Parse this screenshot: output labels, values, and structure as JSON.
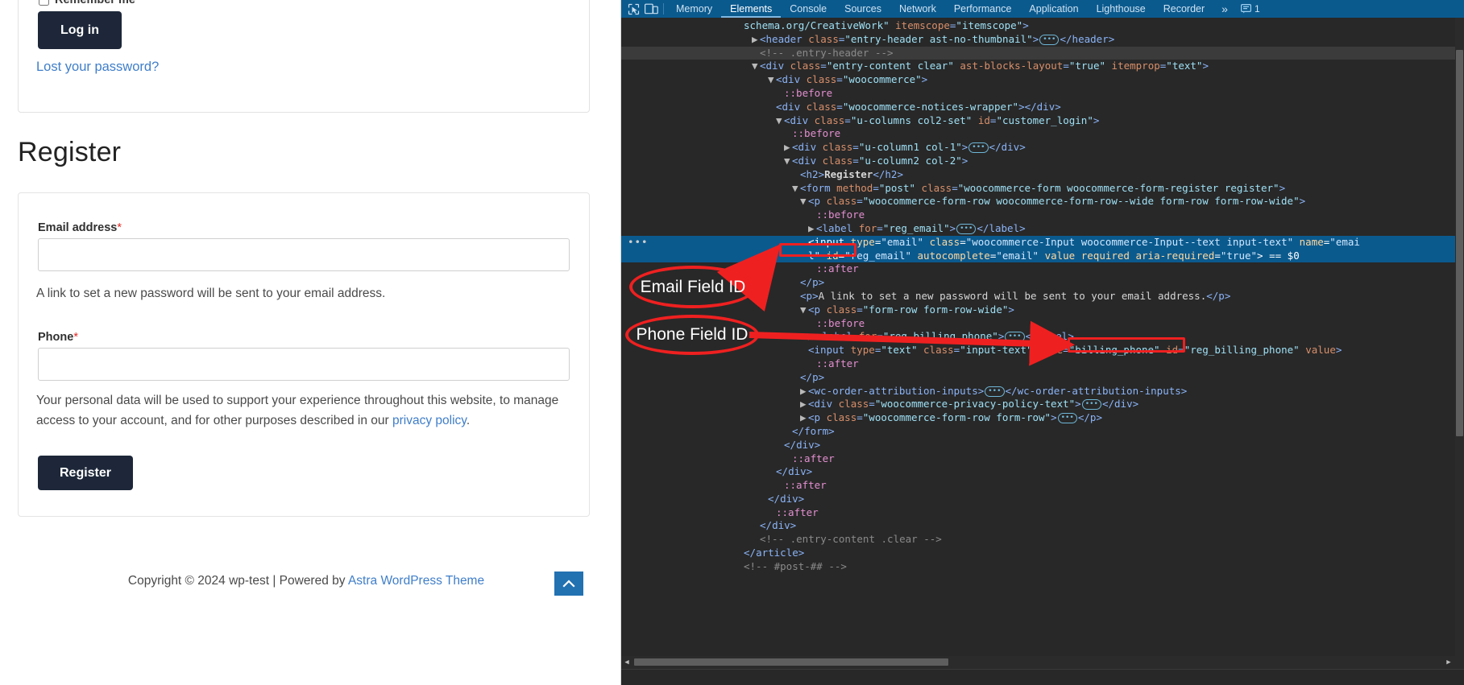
{
  "page": {
    "remember_me_label": "Remember me",
    "login_button": "Log in",
    "lost_password_link": "Lost your password?",
    "register_heading": "Register",
    "email_label": "Email address",
    "email_value": "",
    "email_placeholder": "",
    "email_helper": "A link to set a new password will be sent to your email address.",
    "phone_label": "Phone",
    "phone_value": "",
    "phone_placeholder": "",
    "required_marker": "*",
    "privacy_prefix": "Your personal data will be used to support your experience throughout this website, to manage access to your account, and for other purposes described in our ",
    "privacy_link": "privacy policy",
    "privacy_suffix": ".",
    "register_button": "Register",
    "copyright_prefix": "Copyright © 2024 wp-test | Powered by ",
    "copyright_link": "Astra WordPress Theme",
    "scroll_top_icon": "chevron-up-icon",
    "link_color": "#3f7ec9",
    "button_color": "#1d2739",
    "required_color": "#e02b27"
  },
  "devtools": {
    "accent_color": "#0b5a8e",
    "inspect_icon": "inspect-element-icon",
    "device_icon": "device-toolbar-icon",
    "tabs": [
      {
        "label": "Memory",
        "active": false
      },
      {
        "label": "Elements",
        "active": true
      },
      {
        "label": "Console",
        "active": false
      },
      {
        "label": "Sources",
        "active": false
      },
      {
        "label": "Network",
        "active": false
      },
      {
        "label": "Performance",
        "active": false
      },
      {
        "label": "Application",
        "active": false
      },
      {
        "label": "Lighthouse",
        "active": false
      },
      {
        "label": "Recorder",
        "active": false
      }
    ],
    "more_tabs_label": "»",
    "issues_icon": "issues-icon",
    "issues_count": "1",
    "dom_lines": [
      {
        "indent": 6,
        "state": "none",
        "html": "<span class=\"val\">schema.org/CreativeWork\"</span> <span class=\"attr\">itemscope</span><span class=\"punc\">=</span><span class=\"val\">\"itemscope\"</span><span class=\"punc\">&gt;</span>"
      },
      {
        "indent": 7,
        "state": "none",
        "html": "<span class=\"tri\">▶</span><span class=\"punc\">&lt;</span><span class=\"tag\">header</span> <span class=\"attr\">class</span><span class=\"punc\">=</span><span class=\"val\">\"entry-header ast-no-thumbnail\"</span><span class=\"punc\">&gt;</span><span class=\"ell\">•••</span><span class=\"punc\">&lt;/</span><span class=\"tag\">header</span><span class=\"punc\">&gt;</span>"
      },
      {
        "indent": 8,
        "state": "grey",
        "html": "<span class=\"comment\">&lt;!-- .entry-header --&gt;</span>"
      },
      {
        "indent": 7,
        "state": "none",
        "html": "<span class=\"tri\">▼</span><span class=\"punc\">&lt;</span><span class=\"tag\">div</span> <span class=\"attr\">class</span><span class=\"punc\">=</span><span class=\"val\">\"entry-content clear\"</span> <span class=\"attr\">ast-blocks-layout</span><span class=\"punc\">=</span><span class=\"val\">\"true\"</span> <span class=\"attr\">itemprop</span><span class=\"punc\">=</span><span class=\"val\">\"text\"</span><span class=\"punc\">&gt;</span>"
      },
      {
        "indent": 9,
        "state": "none",
        "html": "<span class=\"tri\">▼</span><span class=\"punc\">&lt;</span><span class=\"tag\">div</span> <span class=\"attr\">class</span><span class=\"punc\">=</span><span class=\"val\">\"woocommerce\"</span><span class=\"punc\">&gt;</span>"
      },
      {
        "indent": 11,
        "state": "none",
        "html": "<span class=\"pseudo\">::before</span>"
      },
      {
        "indent": 10,
        "state": "none",
        "html": "<span class=\"punc\">&lt;</span><span class=\"tag\">div</span> <span class=\"attr\">class</span><span class=\"punc\">=</span><span class=\"val\">\"woocommerce-notices-wrapper\"</span><span class=\"punc\">&gt;&lt;/</span><span class=\"tag\">div</span><span class=\"punc\">&gt;</span>"
      },
      {
        "indent": 10,
        "state": "none",
        "html": "<span class=\"tri\">▼</span><span class=\"punc\">&lt;</span><span class=\"tag\">div</span> <span class=\"attr\">class</span><span class=\"punc\">=</span><span class=\"val\">\"u-columns col2-set\"</span> <span class=\"attr\">id</span><span class=\"punc\">=</span><span class=\"val\">\"customer_login\"</span><span class=\"punc\">&gt;</span>"
      },
      {
        "indent": 12,
        "state": "none",
        "html": "<span class=\"pseudo\">::before</span>"
      },
      {
        "indent": 11,
        "state": "none",
        "html": "<span class=\"tri\">▶</span><span class=\"punc\">&lt;</span><span class=\"tag\">div</span> <span class=\"attr\">class</span><span class=\"punc\">=</span><span class=\"val\">\"u-column1 col-1\"</span><span class=\"punc\">&gt;</span><span class=\"ell\">•••</span><span class=\"punc\">&lt;/</span><span class=\"tag\">div</span><span class=\"punc\">&gt;</span>"
      },
      {
        "indent": 11,
        "state": "none",
        "html": "<span class=\"tri\">▼</span><span class=\"punc\">&lt;</span><span class=\"tag\">div</span> <span class=\"attr\">class</span><span class=\"punc\">=</span><span class=\"val\">\"u-column2 col-2\"</span><span class=\"punc\">&gt;</span>"
      },
      {
        "indent": 13,
        "state": "none",
        "html": "<span class=\"punc\">&lt;</span><span class=\"tag\">h2</span><span class=\"punc\">&gt;</span><span class=\"txt\" style=\"font-weight:bold\">Register</span><span class=\"punc\">&lt;/</span><span class=\"tag\">h2</span><span class=\"punc\">&gt;</span>"
      },
      {
        "indent": 12,
        "state": "none",
        "html": "<span class=\"tri\">▼</span><span class=\"punc\">&lt;</span><span class=\"tag\">form</span> <span class=\"attr\">method</span><span class=\"punc\">=</span><span class=\"val\">\"post\"</span> <span class=\"attr\">class</span><span class=\"punc\">=</span><span class=\"val\">\"woocommerce-form woocommerce-form-register register\"</span><span class=\"punc\">&gt;</span>"
      },
      {
        "indent": 13,
        "state": "none",
        "html": "<span class=\"tri\">▼</span><span class=\"punc\">&lt;</span><span class=\"tag\">p</span> <span class=\"attr\">class</span><span class=\"punc\">=</span><span class=\"val\">\"woocommerce-form-row woocommerce-form-row--wide form-row form-row-wide\"</span><span class=\"punc\">&gt;</span>"
      },
      {
        "indent": 15,
        "state": "none",
        "html": "<span class=\"pseudo\">::before</span>"
      },
      {
        "indent": 14,
        "state": "none",
        "html": "<span class=\"tri\">▶</span><span class=\"punc\">&lt;</span><span class=\"tag\">label</span> <span class=\"attr\">for</span><span class=\"punc\">=</span><span class=\"val\">\"reg_email\"</span><span class=\"punc\">&gt;</span><span class=\"ell\">•••</span><span class=\"punc\">&lt;/</span><span class=\"tag\">label</span><span class=\"punc\">&gt;</span>"
      },
      {
        "indent": 14,
        "state": "sel",
        "html": "<span class=\"punc\">&lt;</span><span class=\"tag\">input</span> <span class=\"attr\">type</span><span class=\"punc\">=</span><span class=\"val\">\"email\"</span> <span class=\"attr\">class</span><span class=\"punc\">=</span><span class=\"val\">\"woocommerce-Input woocommerce-Input--text input-text\"</span> <span class=\"attr\">name</span><span class=\"punc\">=</span><span class=\"val\">\"emai</span>"
      },
      {
        "indent": 14,
        "state": "sel2",
        "html": "<span class=\"val\">l\"</span> <span class=\"attr\">id</span><span class=\"punc\">=</span><span class=\"val\">\"reg_email\"</span> <span class=\"attr\">autocomplete</span><span class=\"punc\">=</span><span class=\"val\">\"email\"</span> <span class=\"attr\">value</span> <span class=\"attr\">required</span> <span class=\"attr\">aria-required</span><span class=\"punc\">=</span><span class=\"val\">\"true\"</span><span class=\"punc\">&gt;</span> <span class=\"txt\">== $0</span>"
      },
      {
        "indent": 15,
        "state": "none",
        "html": "<span class=\"pseudo\">::after</span>"
      },
      {
        "indent": 13,
        "state": "none",
        "html": "<span class=\"punc\">&lt;/</span><span class=\"tag\">p</span><span class=\"punc\">&gt;</span>"
      },
      {
        "indent": 13,
        "state": "none",
        "html": "<span class=\"punc\">&lt;</span><span class=\"tag\">p</span><span class=\"punc\">&gt;</span><span class=\"txt\">A link to set a new password will be sent to your email address.</span><span class=\"punc\">&lt;/</span><span class=\"tag\">p</span><span class=\"punc\">&gt;</span>"
      },
      {
        "indent": 13,
        "state": "none",
        "html": "<span class=\"tri\">▼</span><span class=\"punc\">&lt;</span><span class=\"tag\">p</span> <span class=\"attr\">class</span><span class=\"punc\">=</span><span class=\"val\">\"form-row form-row-wide\"</span><span class=\"punc\">&gt;</span>"
      },
      {
        "indent": 15,
        "state": "none",
        "html": "<span class=\"pseudo\">::before</span>"
      },
      {
        "indent": 14,
        "state": "none",
        "html": "<span class=\"tri\">▶</span><span class=\"punc\">&lt;</span><span class=\"tag\">label</span> <span class=\"attr\">for</span><span class=\"punc\">=</span><span class=\"val\">\"reg_billing_phone\"</span><span class=\"punc\">&gt;</span><span class=\"ell\">•••</span><span class=\"punc\">&lt;/</span><span class=\"tag\">label</span><span class=\"punc\">&gt;</span>"
      },
      {
        "indent": 14,
        "state": "none",
        "html": "<span class=\"punc\">&lt;</span><span class=\"tag\">input</span> <span class=\"attr\">type</span><span class=\"punc\">=</span><span class=\"val\">\"text\"</span> <span class=\"attr\">class</span><span class=\"punc\">=</span><span class=\"val\">\"input-text\"</span> <span class=\"attr\">name</span><span class=\"punc\">=</span><span class=\"val\">\"billing_phone\"</span> <span class=\"attr\">id</span><span class=\"punc\">=</span><span class=\"val\">\"reg_billing_phone\"</span> <span class=\"attr\">value</span><span class=\"punc\">&gt;</span>"
      },
      {
        "indent": 15,
        "state": "none",
        "html": "<span class=\"pseudo\">::after</span>"
      },
      {
        "indent": 13,
        "state": "none",
        "html": "<span class=\"punc\">&lt;/</span><span class=\"tag\">p</span><span class=\"punc\">&gt;</span>"
      },
      {
        "indent": 13,
        "state": "none",
        "html": "<span class=\"tri\">▶</span><span class=\"punc\">&lt;</span><span class=\"tag\">wc-order-attribution-inputs</span><span class=\"punc\">&gt;</span><span class=\"ell\">•••</span><span class=\"punc\">&lt;/</span><span class=\"tag\">wc-order-attribution-inputs</span><span class=\"punc\">&gt;</span>"
      },
      {
        "indent": 13,
        "state": "none",
        "html": "<span class=\"tri\">▶</span><span class=\"punc\">&lt;</span><span class=\"tag\">div</span> <span class=\"attr\">class</span><span class=\"punc\">=</span><span class=\"val\">\"woocommerce-privacy-policy-text\"</span><span class=\"punc\">&gt;</span><span class=\"ell\">•••</span><span class=\"punc\">&lt;/</span><span class=\"tag\">div</span><span class=\"punc\">&gt;</span>"
      },
      {
        "indent": 13,
        "state": "none",
        "html": "<span class=\"tri\">▶</span><span class=\"punc\">&lt;</span><span class=\"tag\">p</span> <span class=\"attr\">class</span><span class=\"punc\">=</span><span class=\"val\">\"woocommerce-form-row form-row\"</span><span class=\"punc\">&gt;</span><span class=\"ell\">•••</span><span class=\"punc\">&lt;/</span><span class=\"tag\">p</span><span class=\"punc\">&gt;</span>"
      },
      {
        "indent": 12,
        "state": "none",
        "html": "<span class=\"punc\">&lt;/</span><span class=\"tag\">form</span><span class=\"punc\">&gt;</span>"
      },
      {
        "indent": 11,
        "state": "none",
        "html": "<span class=\"punc\">&lt;/</span><span class=\"tag\">div</span><span class=\"punc\">&gt;</span>"
      },
      {
        "indent": 12,
        "state": "none",
        "html": "<span class=\"pseudo\">::after</span>"
      },
      {
        "indent": 10,
        "state": "none",
        "html": "<span class=\"punc\">&lt;/</span><span class=\"tag\">div</span><span class=\"punc\">&gt;</span>"
      },
      {
        "indent": 11,
        "state": "none",
        "html": "<span class=\"pseudo\">::after</span>"
      },
      {
        "indent": 9,
        "state": "none",
        "html": "<span class=\"punc\">&lt;/</span><span class=\"tag\">div</span><span class=\"punc\">&gt;</span>"
      },
      {
        "indent": 10,
        "state": "none",
        "html": "<span class=\"pseudo\">::after</span>"
      },
      {
        "indent": 8,
        "state": "none",
        "html": "<span class=\"punc\">&lt;/</span><span class=\"tag\">div</span><span class=\"punc\">&gt;</span>"
      },
      {
        "indent": 8,
        "state": "none",
        "html": "<span class=\"comment\">&lt;!-- .entry-content .clear --&gt;</span>"
      },
      {
        "indent": 6,
        "state": "none",
        "html": "<span class=\"punc\">&lt;/</span><span class=\"tag\">article</span><span class=\"punc\">&gt;</span>"
      },
      {
        "indent": 6,
        "state": "none",
        "html": "<span class=\"comment\">&lt;!-- #post-## --&gt;</span>"
      }
    ]
  },
  "annotations": [
    {
      "id": "email-field-id",
      "label": "Email Field ID"
    },
    {
      "id": "phone-field-id",
      "label": "Phone Field ID"
    }
  ]
}
